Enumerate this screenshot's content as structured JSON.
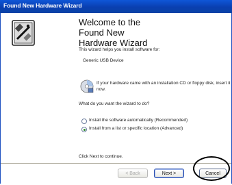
{
  "window": {
    "title": "Found New Hardware Wizard"
  },
  "main": {
    "heading": "Welcome to the Found New Hardware Wizard",
    "intro": "This wizard helps you install software for:",
    "device_name": "Generic USB Device",
    "cd_instruction": "If your hardware came with an installation CD or floppy disk, insert it now.",
    "question": "What do you want the wizard to do?",
    "options": [
      {
        "label": "Install the software automatically (Recommended)",
        "selected": false
      },
      {
        "label": "Install from a list or specific location (Advanced)",
        "selected": true
      }
    ],
    "continue_text": "Click Next to continue."
  },
  "footer": {
    "back_label": "< Back",
    "next_label": "Next >",
    "cancel_label": "Cancel"
  },
  "colors": {
    "titlebar": "#0a3fb0",
    "highlight": "#000000"
  }
}
